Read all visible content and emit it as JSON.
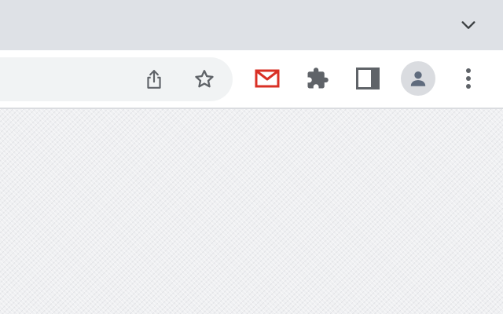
{
  "tabstrip": {
    "tab_search": {
      "icon": "chevron-down-icon"
    }
  },
  "toolbar": {
    "omnibox": {
      "share_icon": "share-icon",
      "bookmark_icon": "star-icon"
    },
    "extensions": [
      {
        "name": "gmail",
        "icon": "gmail-icon",
        "color": "#d93025"
      },
      {
        "name": "extensions-menu",
        "icon": "puzzle-icon",
        "color": "#5f6368"
      }
    ],
    "side_panel_icon": "side-panel-icon",
    "profile_icon": "person-icon",
    "menu_icon": "more-vert-icon"
  },
  "colors": {
    "tabstrip_bg": "#dee1e6",
    "toolbar_bg": "#ffffff",
    "omnibox_bg": "#f1f3f4",
    "icon_color": "#5f6368",
    "avatar_bg": "#dadce0",
    "avatar_fg": "#5f6b7d",
    "gmail_red": "#d93025"
  }
}
